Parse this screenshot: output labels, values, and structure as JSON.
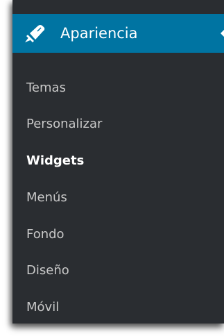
{
  "section": {
    "icon": "paintbrush-icon",
    "label": "Apariencia"
  },
  "menu": {
    "items": [
      {
        "label": "Temas"
      },
      {
        "label": "Personalizar"
      },
      {
        "label": "Widgets",
        "current": true
      },
      {
        "label": "Menús"
      },
      {
        "label": "Fondo"
      },
      {
        "label": "Diseño"
      },
      {
        "label": "Móvil"
      }
    ]
  },
  "colors": {
    "header_bg": "#0074a2",
    "menu_bg": "#2a2d31",
    "item_text": "#c8c8c8",
    "current_text": "#ffffff"
  }
}
